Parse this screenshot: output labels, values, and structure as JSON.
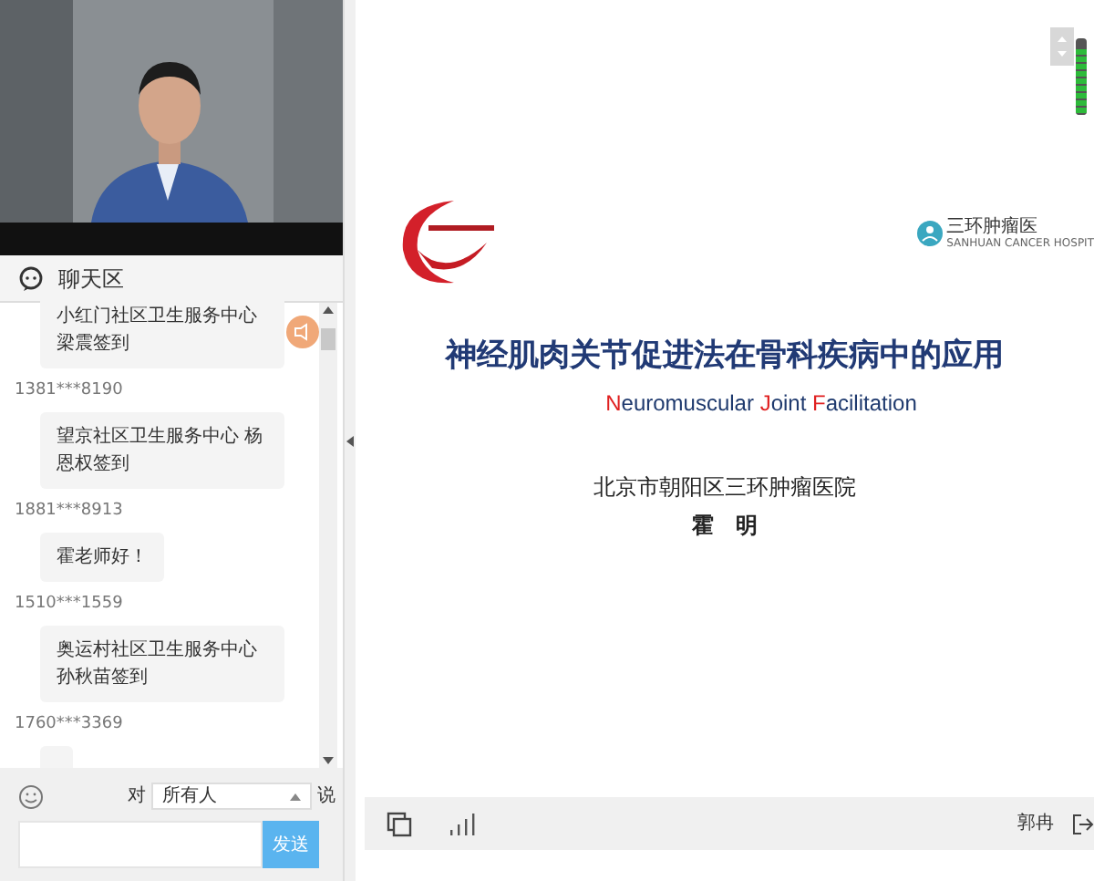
{
  "chat": {
    "title": "聊天区",
    "messages": [
      {
        "text": "小红门社区卫生服务中心梁震签到"
      },
      {
        "user": "1381***8190",
        "text": "望京社区卫生服务中心 杨恩权签到"
      },
      {
        "user": "1881***8913",
        "text": "霍老师好！"
      },
      {
        "user": "1510***1559",
        "text": "奥运村社区卫生服务中心孙秋苗签到"
      },
      {
        "user": "1760***3369"
      }
    ],
    "to_label": "对",
    "recipient": "所有人",
    "say_label": "说",
    "send": "发送"
  },
  "slide": {
    "logo_right": {
      "name": "三环肿瘤医",
      "subname": "SANHUAN CANCER HOSPIT"
    },
    "title": "神经肌肉关节促进法在骨科疾病中的应用",
    "subtitle": [
      {
        "text": "N",
        "highlight": true
      },
      {
        "text": "euromuscular ",
        "highlight": false
      },
      {
        "text": "J",
        "highlight": true
      },
      {
        "text": "oint ",
        "highlight": false
      },
      {
        "text": "F",
        "highlight": true
      },
      {
        "text": "acilitation",
        "highlight": false
      }
    ],
    "hospital": "北京市朝阳区三环肿瘤医院",
    "speaker": "霍　明"
  },
  "mic": {
    "level": 0.85
  },
  "controls": {
    "user": "郭冉"
  }
}
